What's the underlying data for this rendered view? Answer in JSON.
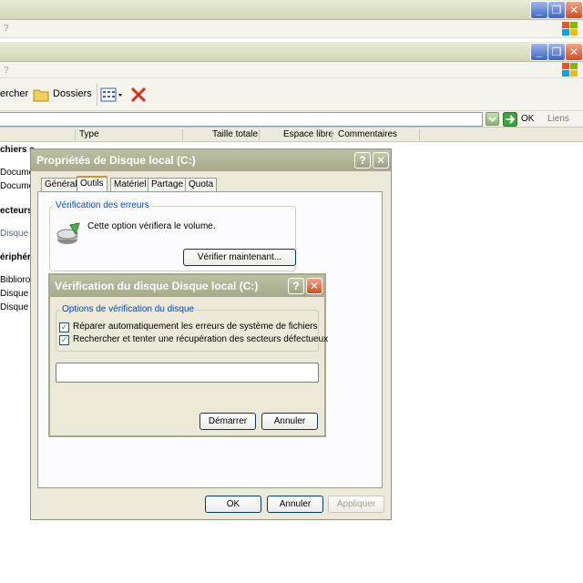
{
  "window1": {
    "menu_hint": "?"
  },
  "window2": {
    "menu_hint": "?"
  },
  "toolbar": {
    "search_label": "ercher",
    "folders_label": "Dossiers"
  },
  "address": {
    "ok_label": "OK",
    "links_label": "Liens"
  },
  "columns": {
    "type": "Type",
    "total_size": "Taille totale",
    "free_space": "Espace libre",
    "comments": "Commentaires"
  },
  "list_fragments": {
    "files_header": "chiers e",
    "doc1": "Documen",
    "doc2": "Documen",
    "drives_header": "ecteurs",
    "disk_local": "Disque lo",
    "devices_header": "ériphéri",
    "biblio": "Bibliorom",
    "disque_a1": "Disque ar",
    "disque_a2": "Disque ar"
  },
  "properties": {
    "title": "Propriétés de Disque local (C:)",
    "help": "?",
    "close": "✕",
    "tabs": [
      "Général",
      "Outils",
      "Matériel",
      "Partage",
      "Quota"
    ],
    "error_check_group": "Vérification des erreurs",
    "error_check_text": "Cette option vérifiera le volume.",
    "check_now_button": "Vérifier maintenant...",
    "ok_button": "OK",
    "cancel_button": "Annuler",
    "apply_button": "Appliquer"
  },
  "check_disk": {
    "title": "Vérification du disque Disque local (C:)",
    "help": "?",
    "close": "✕",
    "options_group": "Options de vérification du disque",
    "option1": "Réparer automatiquement les erreurs de système de fichiers",
    "option2": "Rechercher et tenter une récupération des secteurs défectueux",
    "option1_checked": true,
    "option2_checked": true,
    "progress": 0,
    "start_button": "Démarrer",
    "cancel_button": "Annuler"
  },
  "colors": {
    "xp_olive_title": "#a5aa89",
    "xp_blue_btn": "#3b65c9",
    "xp_red_btn": "#d8491f",
    "group_label": "#0046d5"
  }
}
